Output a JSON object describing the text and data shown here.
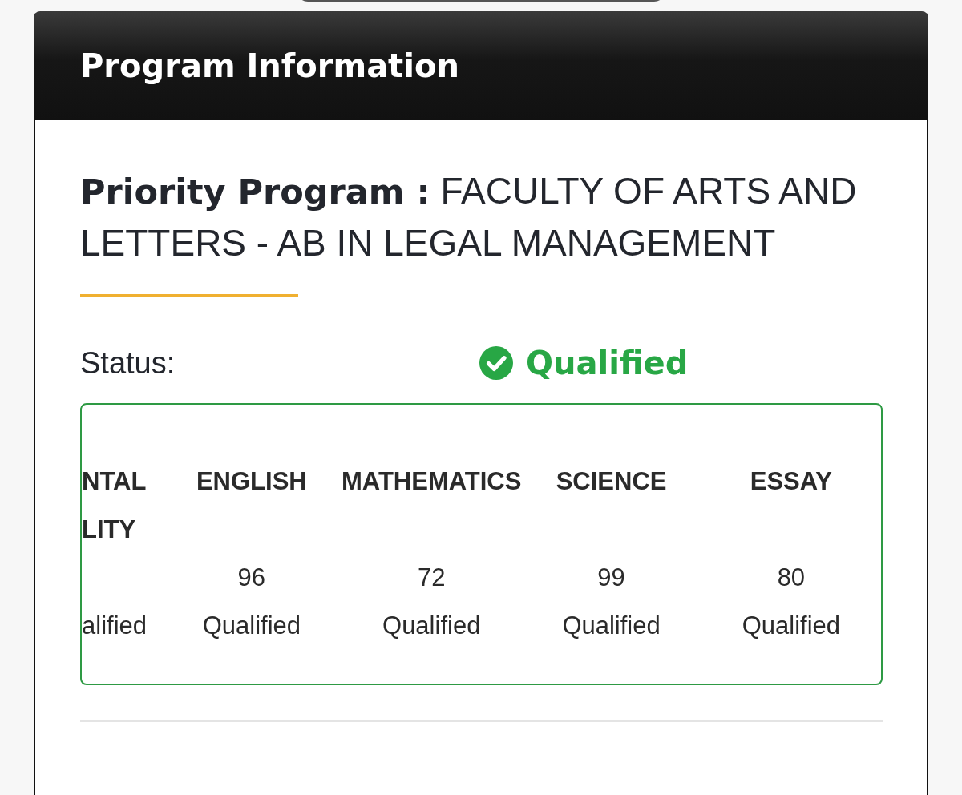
{
  "card": {
    "title": "Program Information"
  },
  "priority_program": "**Priority Program :** FACULTY OF ARTS AND LETTERS - AB IN LEGAL MANAGEMENT",
  "status": {
    "label": "Status:",
    "value": "Qualified",
    "qualified": true
  },
  "subjects": [
    {
      "name": "NTAL LITY",
      "result": "alified",
      "clipped": true
    },
    {
      "name": "ENGLISH",
      "score": "96",
      "result": "Qualified",
      "clipped": false
    },
    {
      "name": "MATHEMATICS",
      "score": "72",
      "result": "Qualified",
      "clipped": false
    },
    {
      "name": "SCIENCE",
      "score": "99",
      "result": "Qualified",
      "clipped": false
    },
    {
      "name": "ESSAY",
      "score": "80",
      "result": "Qualified",
      "clipped": false
    }
  ]
}
